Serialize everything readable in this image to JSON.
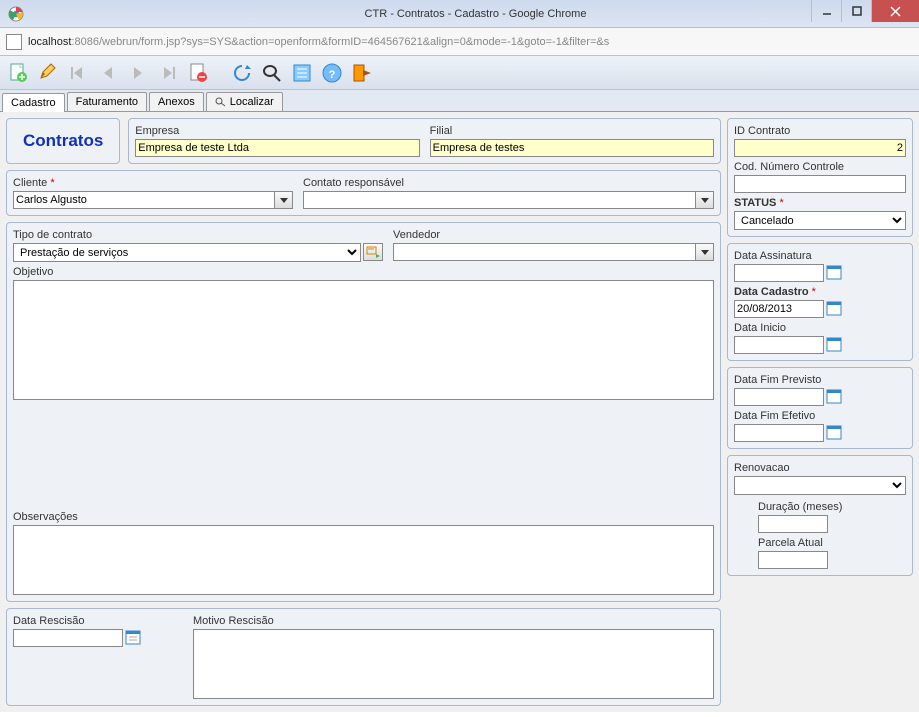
{
  "window": {
    "title": "CTR - Contratos - Cadastro - Google Chrome"
  },
  "addressbar": {
    "host": "localhost",
    "rest": ":8086/webrun/form.jsp?sys=SYS&action=openform&formID=464567621&align=0&mode=-1&goto=-1&filter=&s"
  },
  "tabs": {
    "cadastro": "Cadastro",
    "faturamento": "Faturamento",
    "anexos": "Anexos",
    "localizar": "Localizar"
  },
  "header": {
    "title": "Contratos",
    "empresa_label": "Empresa",
    "empresa_value": "Empresa de teste Ltda",
    "filial_label": "Filial",
    "filial_value": "Empresa de testes"
  },
  "main": {
    "cliente_label": "Cliente",
    "cliente_value": "Carlos Algusto",
    "contato_label": "Contato responsável",
    "contato_value": "",
    "tipo_label": "Tipo de contrato",
    "tipo_value": "Prestação de serviços",
    "vendedor_label": "Vendedor",
    "vendedor_value": "",
    "objetivo_label": "Objetivo",
    "objetivo_value": "",
    "observacoes_label": "Observações",
    "observacoes_value": ""
  },
  "rescisao": {
    "data_label": "Data Rescisão",
    "data_value": "",
    "motivo_label": "Motivo Rescisão",
    "motivo_value": ""
  },
  "side": {
    "id_label": "ID Contrato",
    "id_value": "2",
    "cod_label": "Cod. Número Controle",
    "cod_value": "",
    "status_label": "STATUS",
    "status_value": "Cancelado",
    "assinatura_label": "Data Assinatura",
    "assinatura_value": "",
    "cadastro_label": "Data Cadastro",
    "cadastro_value": "20/08/2013",
    "inicio_label": "Data Inicio",
    "inicio_value": "",
    "fimprev_label": "Data Fim Previsto",
    "fimprev_value": "",
    "fimefet_label": "Data Fim Efetivo",
    "fimefet_value": "",
    "renov_label": "Renovacao",
    "renov_value": "",
    "duracao_label": "Duração (meses)",
    "duracao_value": "",
    "parcela_label": "Parcela Atual",
    "parcela_value": ""
  }
}
